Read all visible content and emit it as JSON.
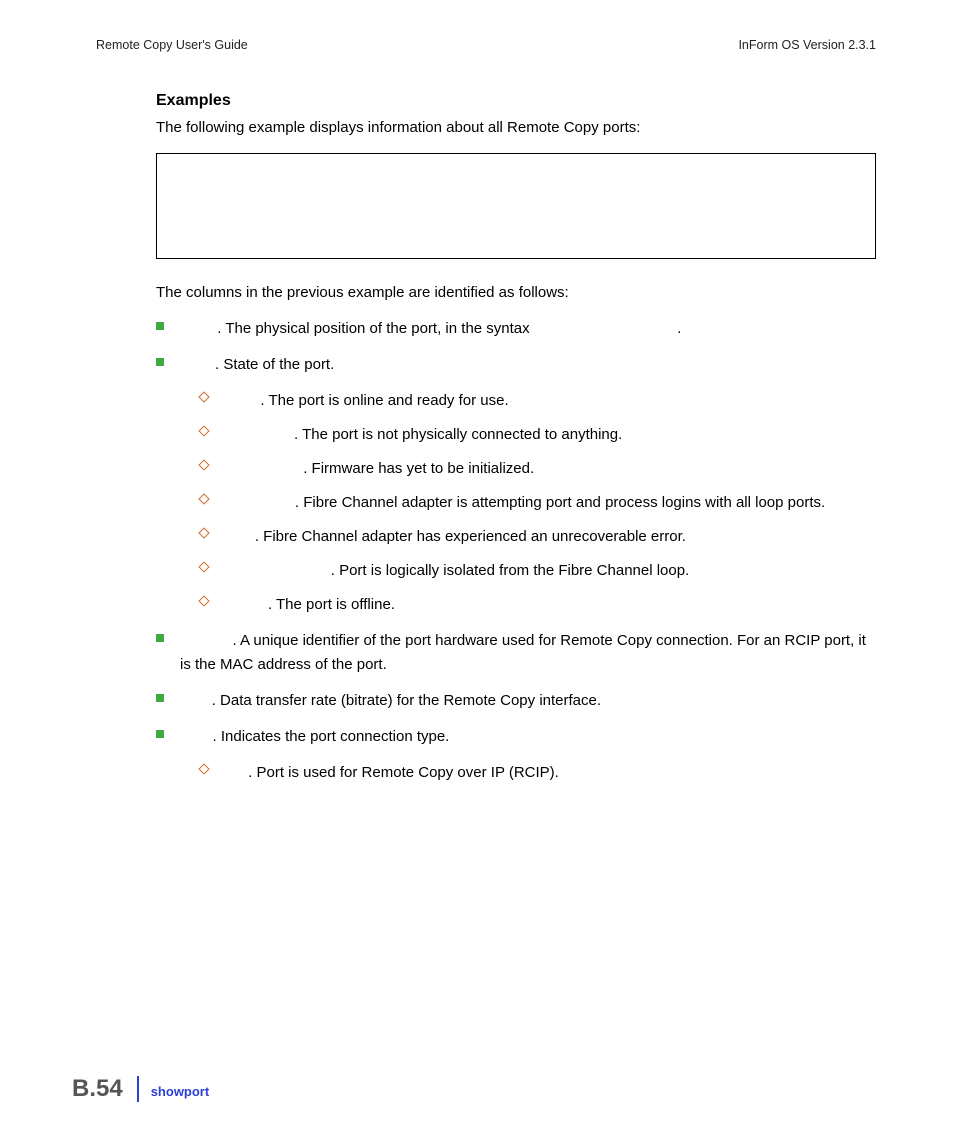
{
  "header": {
    "left": "Remote Copy User's Guide",
    "right": "InForm OS Version 2.3.1"
  },
  "section": {
    "heading": "Examples",
    "intro": "The following example displays information about all Remote Copy ports:",
    "columns_intro": "The columns in the previous example are identified as follows:"
  },
  "items": {
    "nsp": ". The physical position of the port, in the syntax",
    "nsp_tail": ".",
    "state": ". State of the port.",
    "sub": {
      "ready": ". The port is online and ready for use.",
      "loss_sync": ".  The port is not physically connected to anything.",
      "config_wait": ". Firmware has yet to be initialized.",
      "login_wait": ". Fibre Channel adapter is attempting port and process logins with all loop ports.",
      "error": ". Fibre Channel adapter has experienced an unrecoverable error.",
      "non_participate": ". Port is logically isolated from the Fibre Channel loop.",
      "offline": ". The port is offline."
    },
    "hwaddr": ". A unique identifier of the port hardware used for Remote Copy connection. For an RCIP port, it is the MAC address of the port.",
    "rate": ". Data transfer rate (bitrate) for the Remote Copy interface.",
    "type": ". Indicates the port connection type.",
    "type_sub": {
      "rcip": ". Port is used for Remote Copy over IP (RCIP)."
    }
  },
  "footer": {
    "page": "B.54",
    "section": "showport"
  }
}
